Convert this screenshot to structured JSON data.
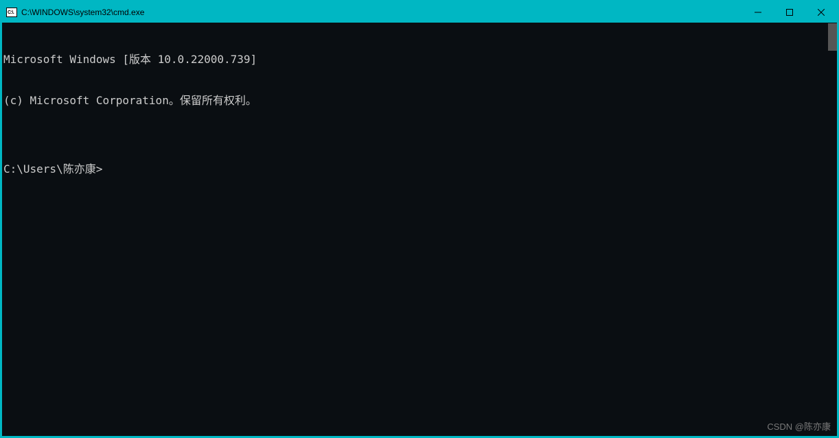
{
  "titlebar": {
    "icon_label": "C:\\.",
    "title": "C:\\WINDOWS\\system32\\cmd.exe"
  },
  "terminal": {
    "line1": "Microsoft Windows [版本 10.0.22000.739]",
    "line2": "(c) Microsoft Corporation。保留所有权利。",
    "blank": "",
    "prompt": "C:\\Users\\陈亦康>"
  },
  "watermark": "CSDN @陈亦康"
}
